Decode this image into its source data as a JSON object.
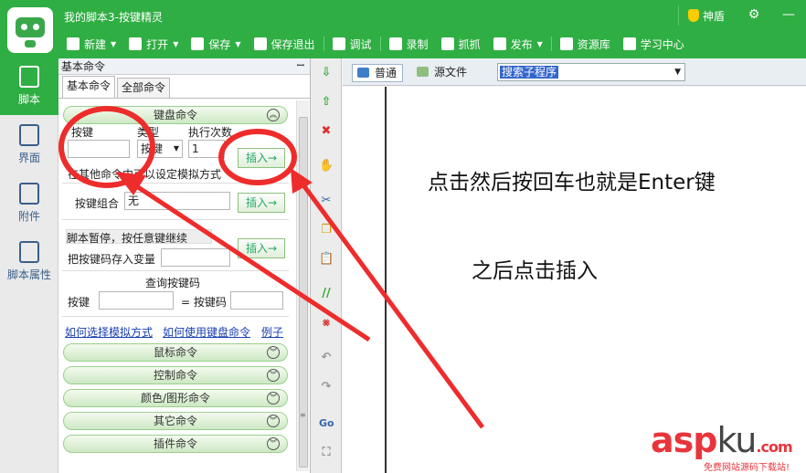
{
  "app": {
    "title": "我的脚本3-按键精灵",
    "shield_label": "神盾",
    "window_controls": [
      "⚙",
      "—"
    ]
  },
  "toolbar": [
    {
      "label": "新建",
      "icon": "plus-icon",
      "caret": true
    },
    {
      "label": "打开",
      "icon": "folder-icon",
      "caret": true
    },
    {
      "label": "保存",
      "icon": "save-icon",
      "caret": true
    },
    {
      "label": "保存退出",
      "icon": "save-exit-icon",
      "caret": false
    },
    {
      "label": "调试",
      "icon": "play-icon",
      "caret": false
    },
    {
      "label": "录制",
      "icon": "camera-icon",
      "caret": false
    },
    {
      "label": "抓抓",
      "icon": "grab-icon",
      "caret": false
    },
    {
      "label": "发布",
      "icon": "publish-icon",
      "caret": true
    },
    {
      "label": "资源库",
      "icon": "resource-icon",
      "caret": false
    },
    {
      "label": "学习中心",
      "icon": "learn-icon",
      "caret": false
    }
  ],
  "leftrail": [
    {
      "label": "脚本",
      "icon": "script-icon",
      "active": true
    },
    {
      "label": "界面",
      "icon": "layout-icon",
      "active": false
    },
    {
      "label": "附件",
      "icon": "attachment-icon",
      "active": false
    },
    {
      "label": "脚本属性",
      "icon": "info-icon",
      "active": false
    }
  ],
  "panel": {
    "header": "基本命令",
    "pin": "ꟷ",
    "tabs": [
      "基本命令",
      "全部命令"
    ],
    "keyboard": {
      "section": "键盘命令",
      "col_key": "按键",
      "col_type": "类型",
      "col_count": "执行次数",
      "key_value": "",
      "type_value": "按键",
      "count_value": "1",
      "insert": "插入→",
      "hint": "在其他命令中可以设定模拟方式"
    },
    "combo": {
      "label": "按键组合",
      "value": "无",
      "insert": "插入→"
    },
    "pause": {
      "label": "脚本暂停，按任意键继续",
      "save_label": "把按键码存入变量",
      "insert": "插入→"
    },
    "query": {
      "title": "查询按键码",
      "key_label": "按键",
      "code_label": "= 按键码"
    },
    "links": [
      "如何选择模拟方式",
      "如何使用键盘命令",
      "例子"
    ],
    "sections": [
      "鼠标命令",
      "控制命令",
      "颜色/图形命令",
      "其它命令",
      "插件命令"
    ]
  },
  "editor": {
    "tabs": [
      "普通",
      "源文件"
    ],
    "search_value": "搜索子程序",
    "notes": [
      "点击然后按回车也就是Enter键",
      "之后点击插入"
    ]
  },
  "watermark": {
    "main_a": "asp",
    "main_b": "ku",
    "main_c": ".com",
    "sub": "免费网站源码下载站!"
  }
}
